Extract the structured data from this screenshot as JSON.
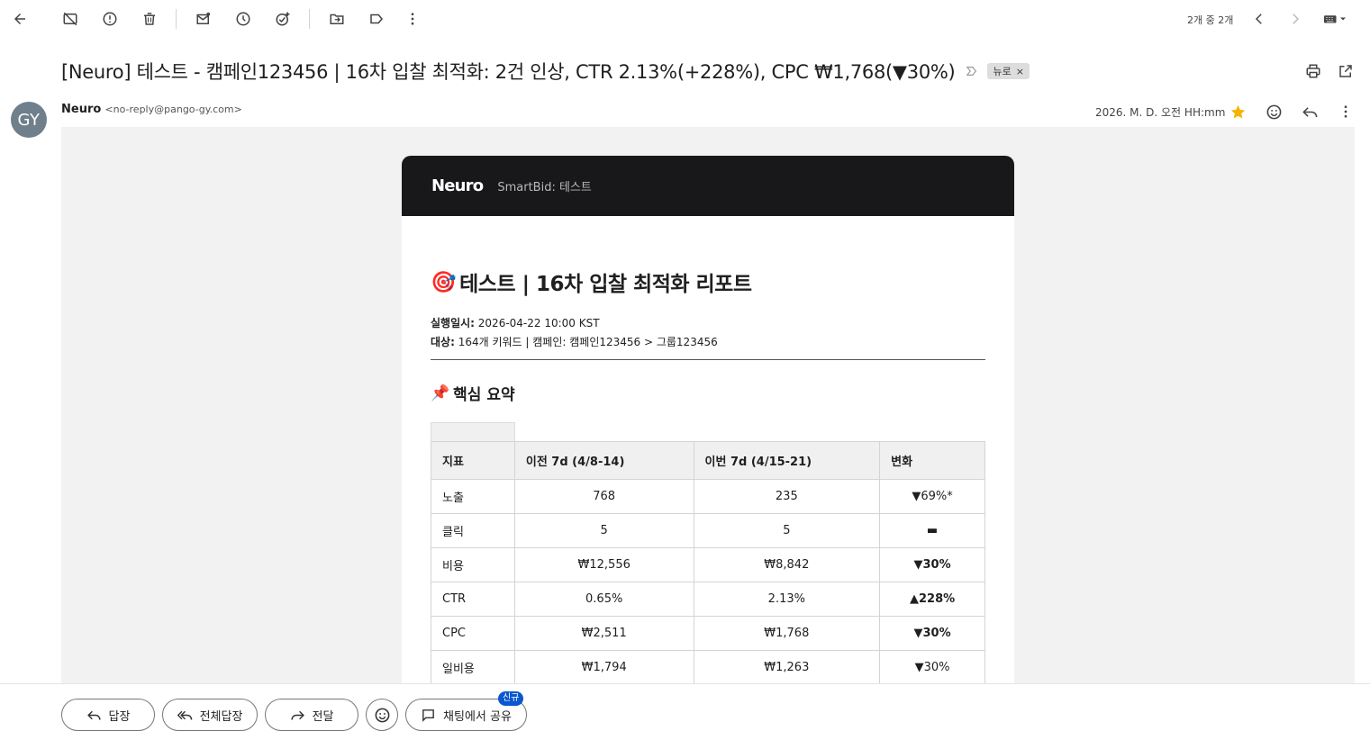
{
  "toolbar": {
    "pager_text": "2개 중 2개"
  },
  "email": {
    "subject": "[Neuro] 테스트 - 캠페인123456 | 16차 입찰 최적화: 2건 인상, CTR 2.13%(+228%), CPC ₩1,768(▼30%)",
    "label": "뉴로",
    "label_remove": "×",
    "sender_name": "Neuro",
    "sender_addr": "<no-reply@pango-gy.com>",
    "avatar_initials": "GY",
    "date": "2026. M. D. 오전 HH:mm"
  },
  "card": {
    "brand": "Neuro",
    "brand_sub": "SmartBid: 테스트",
    "title_emoji": "🎯",
    "title": "테스트 | 16차 입찰 최적화 리포트",
    "meta": {
      "run_label": "실행일시:",
      "run_value": " 2026-04-22 10:00 KST",
      "target_label": "대상:",
      "target_value": " 164개 키워드 | 캠페인: 캠페인123456 > 그룹123456"
    },
    "section_emoji": "📌",
    "section_title": "핵심 요약",
    "table": {
      "headers": [
        "지표",
        "이전 7d (4/8-14)",
        "이번 7d (4/15-21)",
        "변화"
      ],
      "rows": [
        [
          "노출",
          "768",
          "235",
          "▼69%*"
        ],
        [
          "클릭",
          "5",
          "5",
          "▬"
        ],
        [
          "비용",
          "₩12,556",
          "₩8,842",
          "▼30%"
        ],
        [
          "CTR",
          "0.65%",
          "2.13%",
          "▲228%"
        ],
        [
          "CPC",
          "₩2,511",
          "₩1,768",
          "▼30%"
        ],
        [
          "일비용",
          "₩1,794",
          "₩1,263",
          "▼30%"
        ]
      ]
    }
  },
  "bottom": {
    "reply": "답장",
    "reply_all": "전체답장",
    "forward": "전달",
    "share_chat": "채팅에서 공유",
    "new_badge": "신규"
  }
}
